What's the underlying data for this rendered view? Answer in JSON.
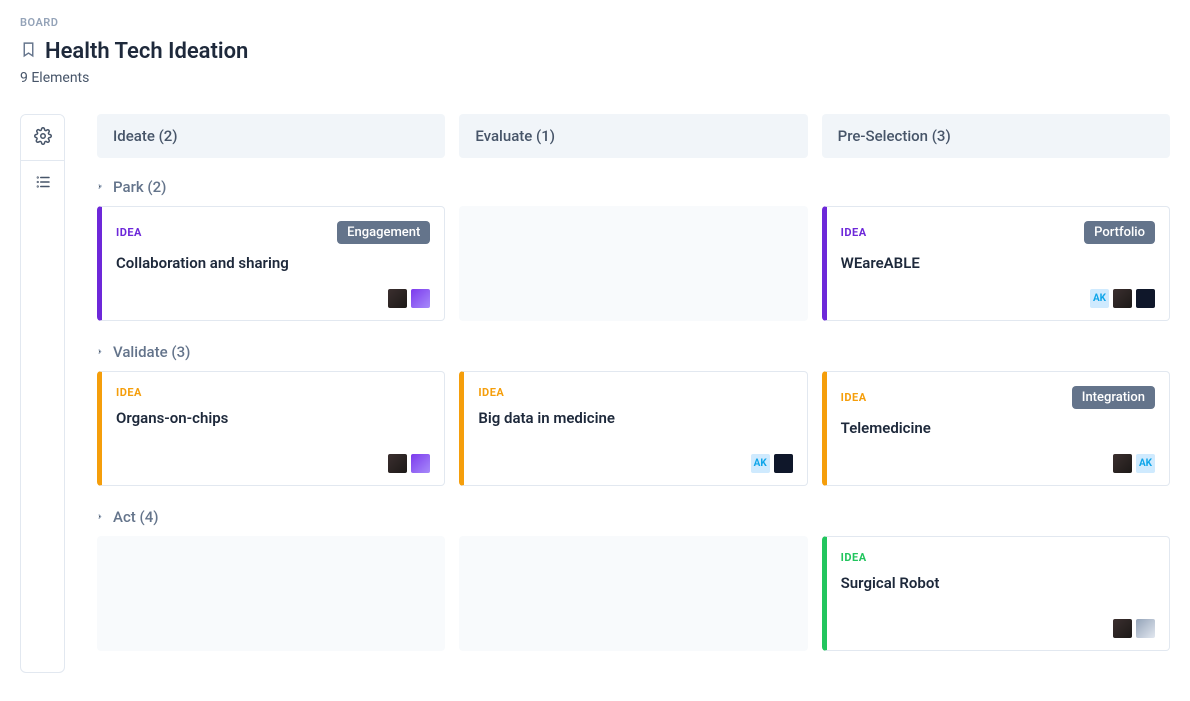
{
  "header": {
    "breadcrumb": "BOARD",
    "title": "Health Tech Ideation",
    "subtitle": "9 Elements"
  },
  "columns": [
    {
      "label": "Ideate (2)"
    },
    {
      "label": "Evaluate (1)"
    },
    {
      "label": "Pre-Selection (3)"
    }
  ],
  "lanes": {
    "park": {
      "label": "Park (2)"
    },
    "validate": {
      "label": "Validate (3)"
    },
    "act": {
      "label": "Act (4)"
    }
  },
  "cards": {
    "collab": {
      "type": "IDEA",
      "title": "Collaboration and sharing",
      "tag": "Engagement"
    },
    "weareable": {
      "type": "IDEA",
      "title": "WEareABLE",
      "tag": "Portfolio"
    },
    "organs": {
      "type": "IDEA",
      "title": "Organs-on-chips"
    },
    "bigdata": {
      "type": "IDEA",
      "title": "Big data in medicine"
    },
    "telemed": {
      "type": "IDEA",
      "title": "Telemedicine",
      "tag": "Integration"
    },
    "surgical": {
      "type": "IDEA",
      "title": "Surgical Robot"
    }
  },
  "avatars": {
    "ak": "AK"
  }
}
